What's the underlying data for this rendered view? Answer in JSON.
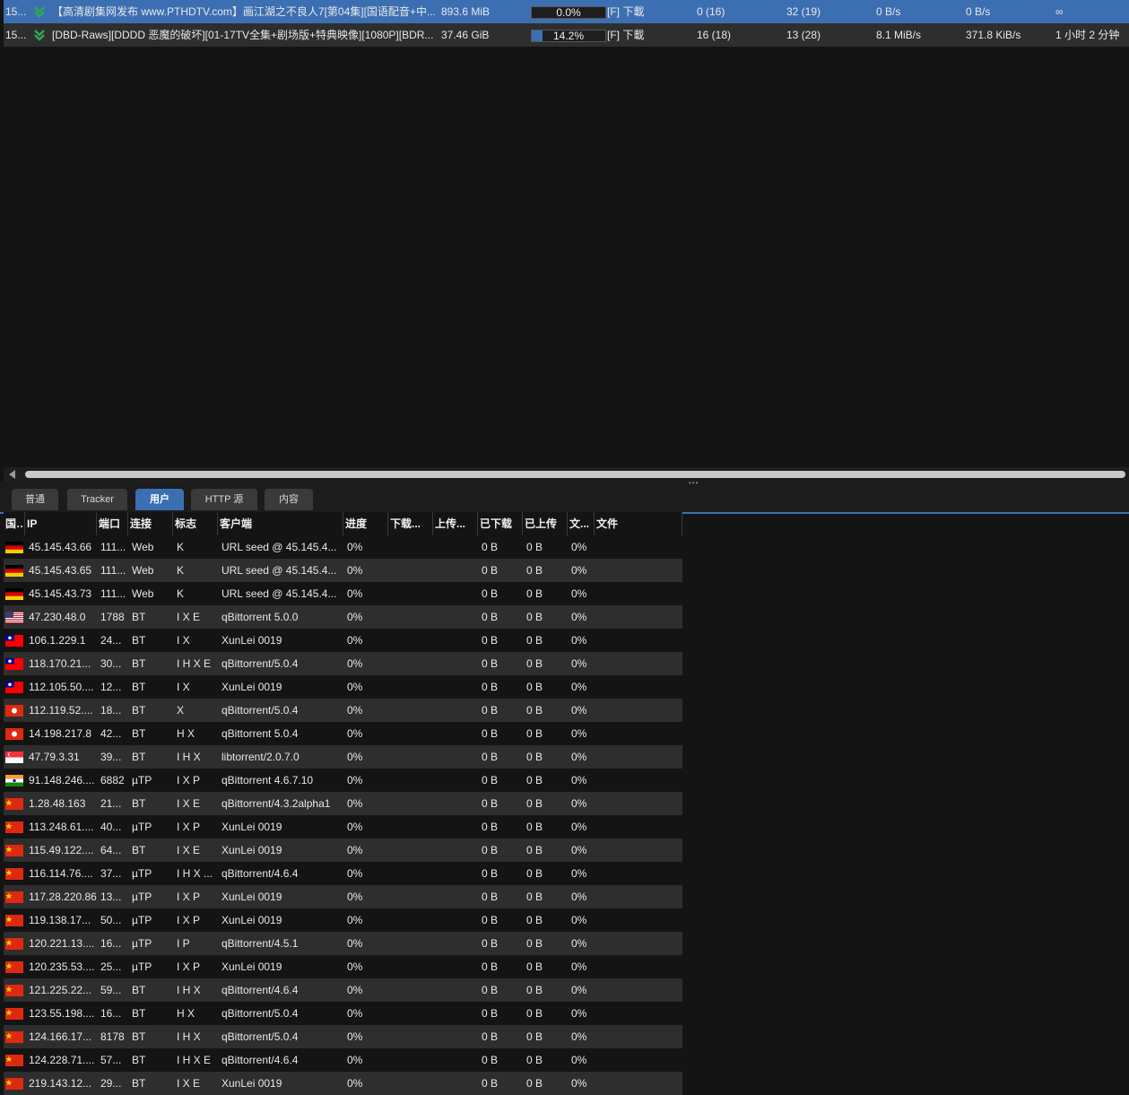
{
  "torrents": [
    {
      "num": "15...",
      "name": "【高清剧集网发布 www.PTHDTV.com】画江湖之不良人7[第04集][国语配音+中...",
      "size": "893.6 MiB",
      "progress_text": "0.0%",
      "progress": 0.0,
      "status": "[F] 下載",
      "seeds": "0 (16)",
      "peers": "32 (19)",
      "down_speed": "0 B/s",
      "up_speed": "0 B/s",
      "eta": "∞",
      "selected": true
    },
    {
      "num": "15...",
      "name": "[DBD-Raws][DDDD 恶魔的破坏][01-17TV全集+剧场版+特典映像][1080P][BDR...",
      "size": "37.46 GiB",
      "progress_text": "14.2%",
      "progress": 0.142,
      "status": "[F] 下載",
      "seeds": "16 (18)",
      "peers": "13 (28)",
      "down_speed": "8.1 MiB/s",
      "up_speed": "371.8 KiB/s",
      "eta": "1 小时 2 分钟",
      "selected": false
    }
  ],
  "tabs": [
    "普通",
    "Tracker",
    "用户",
    "HTTP 源",
    "内容"
  ],
  "active_tab": 2,
  "columns": [
    "国...",
    "IP",
    "端口",
    "连接",
    "标志",
    "客户端",
    "进度",
    "下载...",
    "上传...",
    "已下载",
    "已上传",
    "文...",
    "文件"
  ],
  "peers": [
    {
      "flag": "de",
      "ip": "45.145.43.66",
      "port": "111...",
      "conn": "Web",
      "flags": "K",
      "client": "URL seed @ 45.145.4...",
      "progress": "0%",
      "downloaded": "0 B",
      "uploaded": "0 B",
      "relevance": "0%"
    },
    {
      "flag": "de",
      "ip": "45.145.43.65",
      "port": "111...",
      "conn": "Web",
      "flags": "K",
      "client": "URL seed @ 45.145.4...",
      "progress": "0%",
      "downloaded": "0 B",
      "uploaded": "0 B",
      "relevance": "0%"
    },
    {
      "flag": "de",
      "ip": "45.145.43.73",
      "port": "111...",
      "conn": "Web",
      "flags": "K",
      "client": "URL seed @ 45.145.4...",
      "progress": "0%",
      "downloaded": "0 B",
      "uploaded": "0 B",
      "relevance": "0%"
    },
    {
      "flag": "us",
      "ip": "47.230.48.0",
      "port": "1788",
      "conn": "BT",
      "flags": "I X E",
      "client": "qBittorrent 5.0.0",
      "progress": "0%",
      "downloaded": "0 B",
      "uploaded": "0 B",
      "relevance": "0%"
    },
    {
      "flag": "tw",
      "ip": "106.1.229.1",
      "port": "24...",
      "conn": "BT",
      "flags": "I X",
      "client": "XunLei 0019",
      "progress": "0%",
      "downloaded": "0 B",
      "uploaded": "0 B",
      "relevance": "0%"
    },
    {
      "flag": "tw",
      "ip": "118.170.21...",
      "port": "30...",
      "conn": "BT",
      "flags": "I H X E",
      "client": "qBittorrent/5.0.4",
      "progress": "0%",
      "downloaded": "0 B",
      "uploaded": "0 B",
      "relevance": "0%"
    },
    {
      "flag": "tw",
      "ip": "112.105.50....",
      "port": "12...",
      "conn": "BT",
      "flags": "I X",
      "client": "XunLei 0019",
      "progress": "0%",
      "downloaded": "0 B",
      "uploaded": "0 B",
      "relevance": "0%"
    },
    {
      "flag": "hk",
      "ip": "112.119.52....",
      "port": "18...",
      "conn": "BT",
      "flags": "X",
      "client": "qBittorrent/5.0.4",
      "progress": "0%",
      "downloaded": "0 B",
      "uploaded": "0 B",
      "relevance": "0%"
    },
    {
      "flag": "hk",
      "ip": "14.198.217.8",
      "port": "42...",
      "conn": "BT",
      "flags": "H X",
      "client": "qBittorrent 5.0.4",
      "progress": "0%",
      "downloaded": "0 B",
      "uploaded": "0 B",
      "relevance": "0%"
    },
    {
      "flag": "sg",
      "ip": "47.79.3.31",
      "port": "39...",
      "conn": "BT",
      "flags": "I H X",
      "client": "libtorrent/2.0.7.0",
      "progress": "0%",
      "downloaded": "0 B",
      "uploaded": "0 B",
      "relevance": "0%"
    },
    {
      "flag": "in",
      "ip": "91.148.246....",
      "port": "6882",
      "conn": "µTP",
      "flags": "I X P",
      "client": "qBittorrent 4.6.7.10",
      "progress": "0%",
      "downloaded": "0 B",
      "uploaded": "0 B",
      "relevance": "0%"
    },
    {
      "flag": "cn",
      "ip": "1.28.48.163",
      "port": "21...",
      "conn": "BT",
      "flags": "I X E",
      "client": "qBittorrent/4.3.2alpha1",
      "progress": "0%",
      "downloaded": "0 B",
      "uploaded": "0 B",
      "relevance": "0%"
    },
    {
      "flag": "cn",
      "ip": "113.248.61....",
      "port": "40...",
      "conn": "µTP",
      "flags": "I X P",
      "client": "XunLei 0019",
      "progress": "0%",
      "downloaded": "0 B",
      "uploaded": "0 B",
      "relevance": "0%"
    },
    {
      "flag": "cn",
      "ip": "115.49.122....",
      "port": "64...",
      "conn": "BT",
      "flags": "I X E",
      "client": "XunLei 0019",
      "progress": "0%",
      "downloaded": "0 B",
      "uploaded": "0 B",
      "relevance": "0%"
    },
    {
      "flag": "cn",
      "ip": "116.114.76....",
      "port": "37...",
      "conn": "µTP",
      "flags": "I H X ...",
      "client": "qBittorrent/4.6.4",
      "progress": "0%",
      "downloaded": "0 B",
      "uploaded": "0 B",
      "relevance": "0%"
    },
    {
      "flag": "cn",
      "ip": "117.28.220.86",
      "port": "13...",
      "conn": "µTP",
      "flags": "I X P",
      "client": "XunLei 0019",
      "progress": "0%",
      "downloaded": "0 B",
      "uploaded": "0 B",
      "relevance": "0%"
    },
    {
      "flag": "cn",
      "ip": "119.138.17...",
      "port": "50...",
      "conn": "µTP",
      "flags": "I X P",
      "client": "XunLei 0019",
      "progress": "0%",
      "downloaded": "0 B",
      "uploaded": "0 B",
      "relevance": "0%"
    },
    {
      "flag": "cn",
      "ip": "120.221.13....",
      "port": "16...",
      "conn": "µTP",
      "flags": "I P",
      "client": "qBittorrent/4.5.1",
      "progress": "0%",
      "downloaded": "0 B",
      "uploaded": "0 B",
      "relevance": "0%"
    },
    {
      "flag": "cn",
      "ip": "120.235.53....",
      "port": "25...",
      "conn": "µTP",
      "flags": "I X P",
      "client": "XunLei 0019",
      "progress": "0%",
      "downloaded": "0 B",
      "uploaded": "0 B",
      "relevance": "0%"
    },
    {
      "flag": "cn",
      "ip": "121.225.22...",
      "port": "59...",
      "conn": "BT",
      "flags": "I H X",
      "client": "qBittorrent/4.6.4",
      "progress": "0%",
      "downloaded": "0 B",
      "uploaded": "0 B",
      "relevance": "0%"
    },
    {
      "flag": "cn",
      "ip": "123.55.198....",
      "port": "16...",
      "conn": "BT",
      "flags": "H X",
      "client": "qBittorrent/5.0.4",
      "progress": "0%",
      "downloaded": "0 B",
      "uploaded": "0 B",
      "relevance": "0%"
    },
    {
      "flag": "cn",
      "ip": "124.166.17...",
      "port": "8178",
      "conn": "BT",
      "flags": "I H X",
      "client": "qBittorrent/5.0.4",
      "progress": "0%",
      "downloaded": "0 B",
      "uploaded": "0 B",
      "relevance": "0%"
    },
    {
      "flag": "cn",
      "ip": "124.228.71....",
      "port": "57...",
      "conn": "BT",
      "flags": "I H X E",
      "client": "qBittorrent/4.6.4",
      "progress": "0%",
      "downloaded": "0 B",
      "uploaded": "0 B",
      "relevance": "0%"
    },
    {
      "flag": "cn",
      "ip": "219.143.12...",
      "port": "29...",
      "conn": "BT",
      "flags": "I X E",
      "client": "XunLei 0019",
      "progress": "0%",
      "downloaded": "0 B",
      "uploaded": "0 B",
      "relevance": "0%"
    }
  ]
}
